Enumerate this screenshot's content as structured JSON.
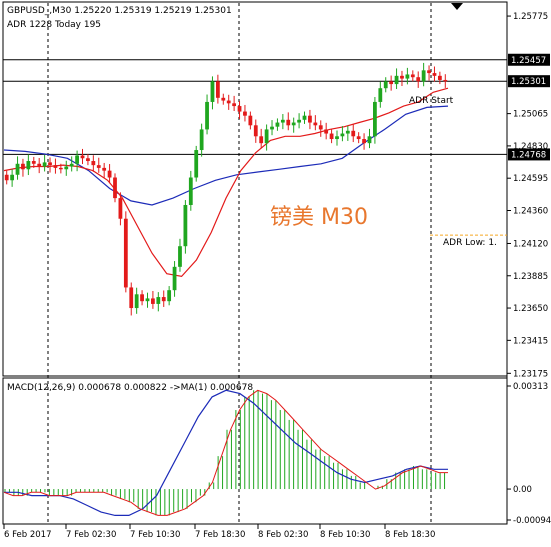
{
  "header": {
    "line1": "GBPUSD_,M30  1.25220 1.25319 1.25219 1.25301",
    "line2": "ADR 1228  Today 195"
  },
  "watermark": "镑美 M30",
  "labels": {
    "adr_start": "ADR Start",
    "adr_low": "ADR Low: 1."
  },
  "macd_label": "MACD(12,26,9) 0.000678 0.000822  ->MA(1) 0.000678",
  "colors": {
    "up": "#1fa61f",
    "down": "#e31a1a",
    "ma_fast": "#e31a1a",
    "ma_slow": "#1c2bb8",
    "macd_hist": "#1fa61f",
    "adr": "#f5a623",
    "box_bg": "#000000",
    "box_fg": "#ffffff"
  },
  "chart_data": [
    {
      "type": "candlestick",
      "symbol": "GBPUSD_",
      "timeframe": "M30",
      "ylim": [
        1.2317,
        1.2579
      ],
      "y_ticks": [
        "1.25775",
        "1.25457",
        "1.25301",
        "1.25065",
        "1.24830",
        "1.24768",
        "1.24595",
        "1.24360",
        "1.24120",
        "1.23885",
        "1.23650",
        "1.23415",
        "1.23175"
      ],
      "x_ticks": [
        "6 Feb 2017",
        "7 Feb 02:30",
        "7 Feb 10:30",
        "7 Feb 18:30",
        "8 Feb 02:30",
        "8 Feb 10:30",
        "8 Feb 18:30"
      ],
      "horizontal_levels": [
        {
          "value": 1.25457,
          "label": "1.25457"
        },
        {
          "value": 1.25301,
          "label": "1.25301"
        },
        {
          "value": 1.24768,
          "label": "1.24768"
        }
      ],
      "adr_low": 1.2413,
      "closes": [
        1.2458,
        1.2462,
        1.247,
        1.2466,
        1.2472,
        1.247,
        1.2468,
        1.2471,
        1.2469,
        1.2467,
        1.2466,
        1.2468,
        1.247,
        1.2476,
        1.2474,
        1.2472,
        1.2469,
        1.2467,
        1.2465,
        1.246,
        1.2445,
        1.243,
        1.238,
        1.2365,
        1.2375,
        1.237,
        1.2372,
        1.2368,
        1.2373,
        1.237,
        1.2378,
        1.2395,
        1.241,
        1.244,
        1.246,
        1.248,
        1.2495,
        1.2515,
        1.253,
        1.2518,
        1.2516,
        1.2514,
        1.2512,
        1.2508,
        1.2505,
        1.2498,
        1.249,
        1.2485,
        1.2495,
        1.2497,
        1.25,
        1.2502,
        1.2498,
        1.25,
        1.2502,
        1.2505,
        1.25,
        1.2498,
        1.2495,
        1.2492,
        1.2488,
        1.249,
        1.2492,
        1.2494,
        1.249,
        1.2488,
        1.2485,
        1.249,
        1.2515,
        1.2525,
        1.253,
        1.2528,
        1.2534,
        1.2532,
        1.2535,
        1.2533,
        1.253,
        1.2538,
        1.2536,
        1.2534,
        1.2531,
        1.253
      ],
      "ma_fast_values": [
        1.2465,
        1.2467,
        1.2468,
        1.2468,
        1.2469,
        1.2468,
        1.2465,
        1.2458,
        1.2445,
        1.2425,
        1.2405,
        1.239,
        1.2388,
        1.24,
        1.242,
        1.2445,
        1.2465,
        1.2478,
        1.2487,
        1.249,
        1.249,
        1.2492,
        1.2495,
        1.2497,
        1.25,
        1.2503,
        1.2507,
        1.2512,
        1.2515,
        1.2522,
        1.2525
      ],
      "ma_slow_values": [
        1.248,
        1.2479,
        1.2477,
        1.2474,
        1.2465,
        1.2452,
        1.2443,
        1.244,
        1.2445,
        1.2452,
        1.2458,
        1.2462,
        1.2464,
        1.2466,
        1.2468,
        1.247,
        1.2474,
        1.2485,
        1.2495,
        1.2506,
        1.2511,
        1.2512
      ]
    },
    {
      "type": "bar",
      "name": "MACD(12,26,9)",
      "ylim": [
        -0.00094,
        0.00313
      ],
      "y_ticks": [
        "0.00313",
        "0.00",
        "-0.00094"
      ],
      "values": [
        -0.0001,
        -0.0002,
        -0.0002,
        -0.0001,
        -0.0001,
        -0.0002,
        -0.0002,
        -0.0002,
        -0.0001,
        -0.0001,
        -0.0001,
        -0.0001,
        -0.0002,
        -0.0003,
        -0.0004,
        -0.0006,
        -0.0007,
        -0.0008,
        -0.0008,
        -0.0007,
        -0.0006,
        -0.0004,
        -0.0002,
        0.0002,
        0.001,
        0.0018,
        0.0024,
        0.0028,
        0.003,
        0.0029,
        0.0027,
        0.0024,
        0.0021,
        0.0018,
        0.0015,
        0.0012,
        0.001,
        0.0008,
        0.0006,
        0.0004,
        0.0002,
        0.0,
        0.0001,
        0.0003,
        0.0005,
        0.0006,
        0.0007,
        0.0006,
        0.0005,
        0.0005
      ],
      "signal_values": [
        -0.0001,
        -0.0001,
        -0.0002,
        -0.0002,
        -0.0002,
        -0.0003,
        -0.0005,
        -0.0007,
        -0.0008,
        -0.0008,
        -0.0006,
        -0.0002,
        0.0006,
        0.0014,
        0.0022,
        0.0028,
        0.003,
        0.0029,
        0.0026,
        0.0022,
        0.0018,
        0.0014,
        0.0011,
        0.0008,
        0.0005,
        0.0003,
        0.0002,
        0.0003,
        0.0004,
        0.0006,
        0.0007,
        0.0006,
        0.0006
      ]
    }
  ]
}
